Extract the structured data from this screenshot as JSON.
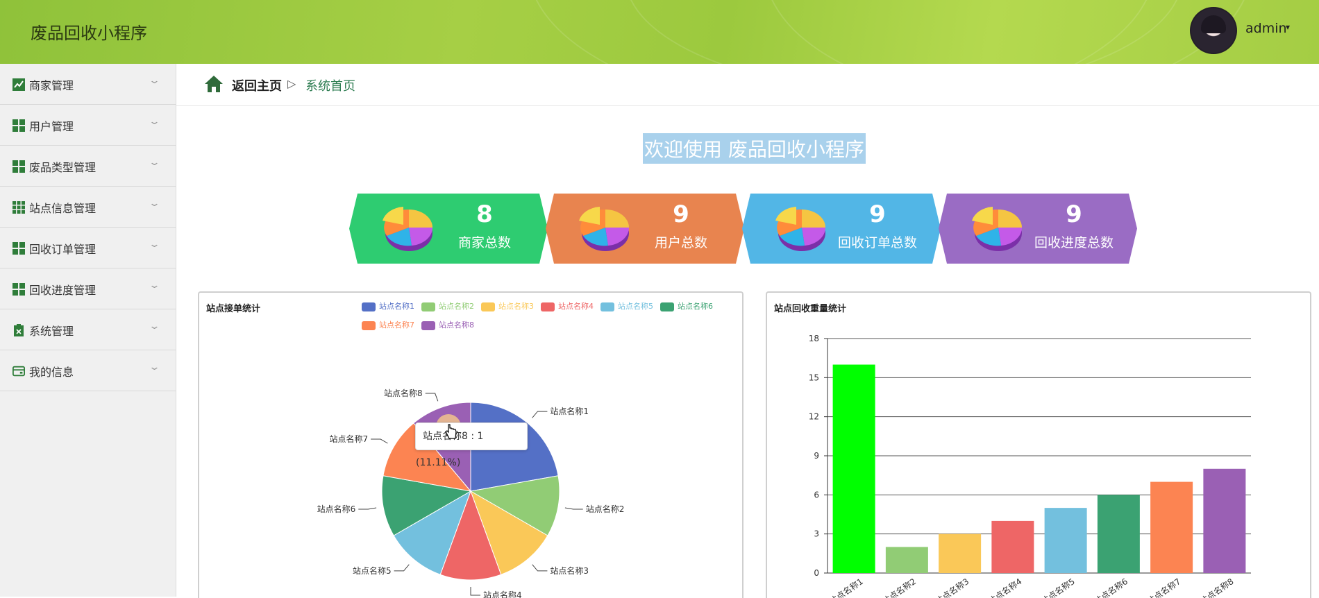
{
  "app": {
    "title": "废品回收小程序"
  },
  "user": {
    "name": "admin"
  },
  "sidebar": {
    "items": [
      {
        "label": "商家管理",
        "icon": "chart-line-icon"
      },
      {
        "label": "用户管理",
        "icon": "grid-icon"
      },
      {
        "label": "废品类型管理",
        "icon": "grid-icon"
      },
      {
        "label": "站点信息管理",
        "icon": "grid-nine-icon"
      },
      {
        "label": "回收订单管理",
        "icon": "grid-icon"
      },
      {
        "label": "回收进度管理",
        "icon": "grid-icon"
      },
      {
        "label": "系统管理",
        "icon": "clipboard-icon"
      },
      {
        "label": "我的信息",
        "icon": "card-icon"
      }
    ]
  },
  "breadcrumb": {
    "home": "返回主页",
    "separator": "▷",
    "current": "系统首页"
  },
  "welcome": "欢迎使用 废品回收小程序",
  "stats": [
    {
      "value": "8",
      "label": "商家总数",
      "color": "#2ecc71"
    },
    {
      "value": "9",
      "label": "用户总数",
      "color": "#e8844f"
    },
    {
      "value": "9",
      "label": "回收订单总数",
      "color": "#52b6e6"
    },
    {
      "value": "9",
      "label": "回收进度总数",
      "color": "#9a6cc4"
    }
  ],
  "tooltip": {
    "text": "站点名称8 : 1 (11.11%)"
  },
  "chart_data": [
    {
      "type": "pie",
      "title": "站点接单统计",
      "categories": [
        "站点名称1",
        "站点名称2",
        "站点名称3",
        "站点名称4",
        "站点名称5",
        "站点名称6",
        "站点名称7",
        "站点名称8"
      ],
      "values": [
        2,
        1,
        1,
        1,
        1,
        1,
        1,
        1
      ],
      "colors": [
        "#5470c6",
        "#91cc75",
        "#fac858",
        "#ee6666",
        "#73c0de",
        "#3ba272",
        "#fc8452",
        "#9a60b4"
      ],
      "legend": "top-right"
    },
    {
      "type": "bar",
      "title": "站点回收重量统计",
      "categories": [
        "站点名称1",
        "站点名称2",
        "站点名称3",
        "站点名称4",
        "站点名称5",
        "站点名称6",
        "站点名称7",
        "站点名称8"
      ],
      "values": [
        16,
        2,
        3,
        4,
        5,
        6,
        7,
        8
      ],
      "colors": [
        "#00ff00",
        "#91cc75",
        "#fac858",
        "#ee6666",
        "#73c0de",
        "#3ba272",
        "#fc8452",
        "#9a60b4"
      ],
      "ylim": [
        0,
        18
      ],
      "yticks": [
        0,
        3,
        6,
        9,
        12,
        15,
        18
      ],
      "grid": true
    }
  ]
}
